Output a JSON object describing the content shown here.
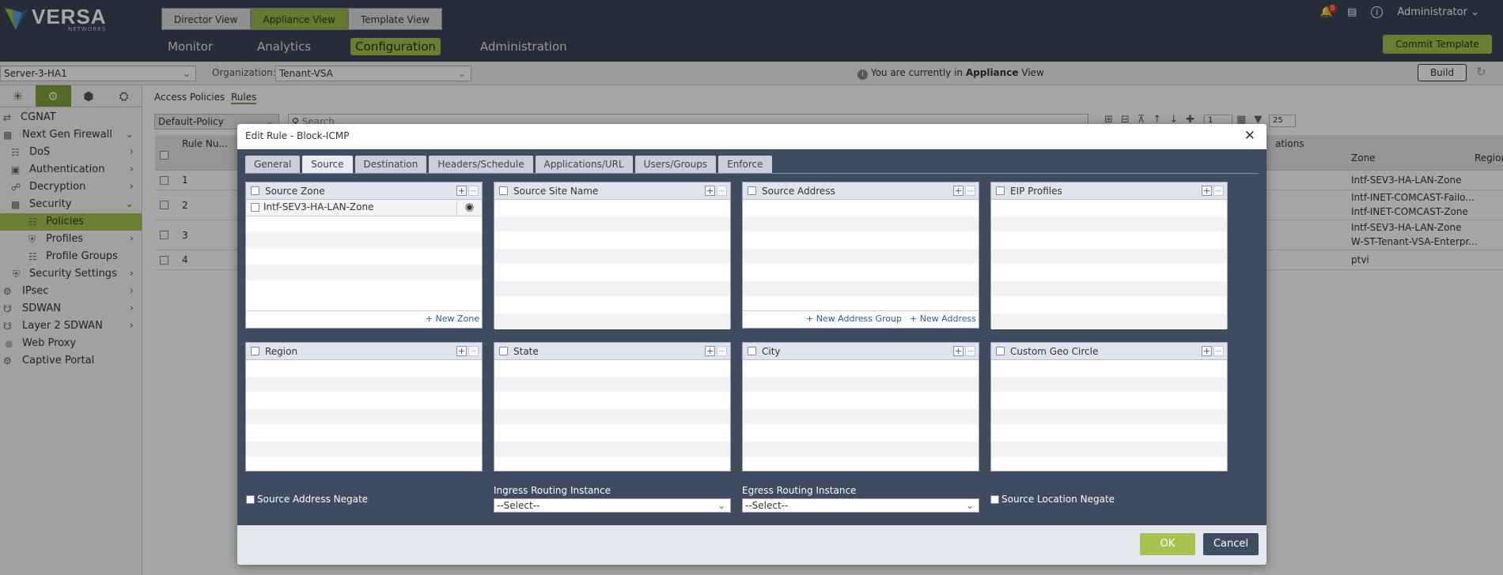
{
  "header": {
    "logo_text": "VERSA",
    "logo_sub": "NETWORKS",
    "views": [
      "Director View",
      "Appliance View",
      "Template View"
    ],
    "nav": [
      "Monitor",
      "Analytics",
      "Configuration",
      "Administration"
    ],
    "notif_count": "0",
    "user": "Administrator",
    "commit_label": "Commit Template"
  },
  "bar2": {
    "device": "Server-3-HA1",
    "org_label": "Organization:",
    "org_value": "Tenant-VSA",
    "view_msg_pre": "You are currently in",
    "view_msg_bold": "Appliance",
    "view_msg_post": "View",
    "build_label": "Build"
  },
  "sidebar": {
    "items": [
      {
        "label": "CGNAT"
      },
      {
        "label": "Next Gen Firewall"
      },
      {
        "label": "DoS"
      },
      {
        "label": "Authentication"
      },
      {
        "label": "Decryption"
      },
      {
        "label": "Security"
      },
      {
        "label": "Policies"
      },
      {
        "label": "Profiles"
      },
      {
        "label": "Profile Groups"
      },
      {
        "label": "Security Settings"
      },
      {
        "label": "IPsec"
      },
      {
        "label": "SDWAN"
      },
      {
        "label": "Layer 2 SDWAN"
      },
      {
        "label": "Web Proxy"
      },
      {
        "label": "Captive Portal"
      }
    ]
  },
  "main": {
    "tabs": [
      "Access Policies",
      "Rules"
    ],
    "policy_select": "Default-Policy",
    "search_placeholder": "Search",
    "page_num": "1",
    "page_size": "25",
    "col_rule": "Rule Nu...",
    "col_ations": "ations",
    "col_zone": "Zone",
    "col_region": "Region",
    "rows": [
      {
        "num": "1",
        "zone": "Intf-SEV3-HA-LAN-Zone",
        "zone2": ""
      },
      {
        "num": "2",
        "zone": "Intf-INET-COMCAST-Failo...",
        "zone2": "Intf-INET-COMCAST-Zone"
      },
      {
        "num": "3",
        "zone": "Intf-SEV3-HA-LAN-Zone",
        "zone2": "W-ST-Tenant-VSA-Enterpr..."
      },
      {
        "num": "4",
        "zone": "ptvi",
        "zone2": ""
      }
    ]
  },
  "modal": {
    "title": "Edit Rule - Block-ICMP",
    "tabs": [
      "General",
      "Source",
      "Destination",
      "Headers/Schedule",
      "Applications/URL",
      "Users/Groups",
      "Enforce"
    ],
    "panels": {
      "source_zone": {
        "title": "Source Zone",
        "entry": "Intf-SEV3-HA-LAN-Zone",
        "link": "+ New Zone"
      },
      "source_site": {
        "title": "Source Site Name"
      },
      "source_address": {
        "title": "Source Address",
        "link1": "+ New Address Group",
        "link2": "+ New Address"
      },
      "eip": {
        "title": "EIP Profiles"
      },
      "region": {
        "title": "Region"
      },
      "state": {
        "title": "State"
      },
      "city": {
        "title": "City"
      },
      "geo": {
        "title": "Custom Geo Circle"
      }
    },
    "src_addr_negate": "Source Address Negate",
    "ingress_label": "Ingress Routing Instance",
    "ingress_value": "--Select--",
    "egress_label": "Egress Routing Instance",
    "egress_value": "--Select--",
    "src_loc_negate": "Source Location Negate",
    "ok": "OK",
    "cancel": "Cancel"
  }
}
